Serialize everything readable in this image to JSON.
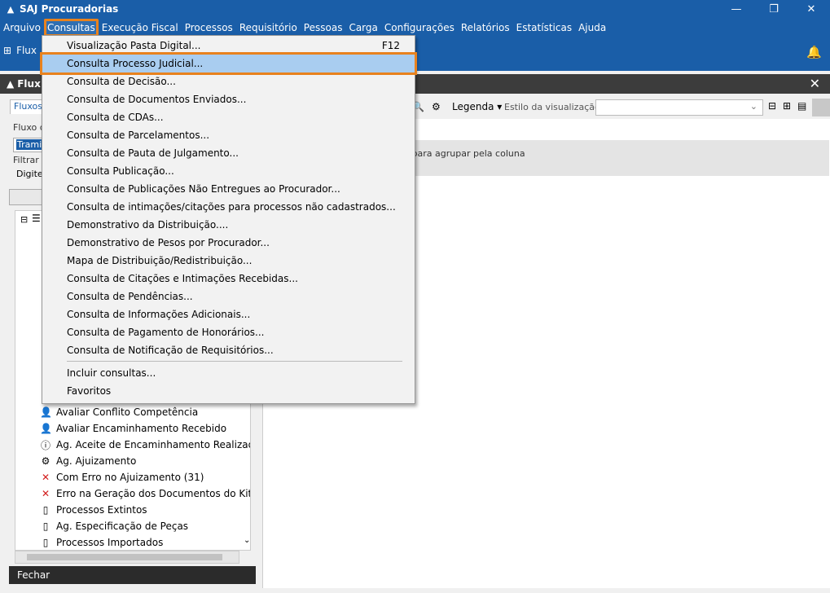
{
  "window": {
    "title": "SAJ Procuradorias",
    "min": "—",
    "restore": "❐",
    "close": "✕"
  },
  "menubar": [
    "Arquivo",
    "Consultas",
    "Execução Fiscal",
    "Processos",
    "Requisitório",
    "Pessoas",
    "Carga",
    "Configurações",
    "Relatórios",
    "Estatísticas",
    "Ajuda"
  ],
  "toolbar": {
    "fluxo_label": "Flux"
  },
  "inner": {
    "title": "Flux"
  },
  "left": {
    "tab": "Fluxos d",
    "fluxo_label": "Fluxo d",
    "fluxo_value": "Tramit",
    "filtrar_label": "Filtrar f",
    "filtrar_value": "Digite",
    "tree_items": [
      {
        "icon": "person-icon",
        "glyph": "👤",
        "label": "Avaliar Conflito Competência"
      },
      {
        "icon": "person-icon",
        "glyph": "👤",
        "label": "Avaliar Encaminhamento Recebido"
      },
      {
        "icon": "info-icon",
        "glyph": "ⓘ",
        "label": "Ag. Aceite de Encaminhamento Realizado"
      },
      {
        "icon": "seal-icon",
        "glyph": "⚙",
        "label": "Ag. Ajuizamento"
      },
      {
        "icon": "error-icon",
        "glyph": "✕",
        "label": "Com Erro no Ajuizamento (31)"
      },
      {
        "icon": "error-icon",
        "glyph": "✕",
        "label": "Erro na Geração dos Documentos do Kit"
      },
      {
        "icon": "document-icon",
        "glyph": "▯",
        "label": "Processos Extintos"
      },
      {
        "icon": "document-icon",
        "glyph": "▯",
        "label": "Ag. Especificação de Peças"
      },
      {
        "icon": "document-icon",
        "glyph": "▯",
        "label": "Processos Importados"
      }
    ],
    "close": "Fechar"
  },
  "right": {
    "legenda": "Legenda ▾",
    "estilo": "Estilo da visualização",
    "group_text": "i para agrupar pela coluna"
  },
  "dropdown": {
    "items": [
      {
        "label": "Visualização Pasta Digital...",
        "shortcut": "F12"
      },
      {
        "label": "Consulta Processo Judicial...",
        "shortcut": ""
      },
      {
        "label": "Consulta de Decisão...",
        "shortcut": ""
      },
      {
        "label": "Consulta de Documentos Enviados...",
        "shortcut": ""
      },
      {
        "label": "Consulta de CDAs...",
        "shortcut": ""
      },
      {
        "label": "Consulta de Parcelamentos...",
        "shortcut": ""
      },
      {
        "label": "Consulta de Pauta de Julgamento...",
        "shortcut": ""
      },
      {
        "label": "Consulta Publicação...",
        "shortcut": ""
      },
      {
        "label": "Consulta de Publicações Não Entregues ao Procurador...",
        "shortcut": ""
      },
      {
        "label": "Consulta de intimações/citações para processos não cadastrados...",
        "shortcut": ""
      },
      {
        "label": "Demonstrativo da Distribuição....",
        "shortcut": ""
      },
      {
        "label": "Demonstrativo de Pesos por Procurador...",
        "shortcut": ""
      },
      {
        "label": "Mapa de Distribuição/Redistribuição...",
        "shortcut": ""
      },
      {
        "label": "Consulta de Citações e Intimações Recebidas...",
        "shortcut": ""
      },
      {
        "label": "Consulta de Pendências...",
        "shortcut": ""
      },
      {
        "label": "Consulta de Informações Adicionais...",
        "shortcut": ""
      },
      {
        "label": "Consulta de Pagamento de Honorários...",
        "shortcut": ""
      },
      {
        "label": "Consulta de Notificação de Requisitórios...",
        "shortcut": ""
      }
    ],
    "extra": [
      {
        "label": "Incluir consultas..."
      },
      {
        "label": "Favoritos"
      }
    ]
  }
}
